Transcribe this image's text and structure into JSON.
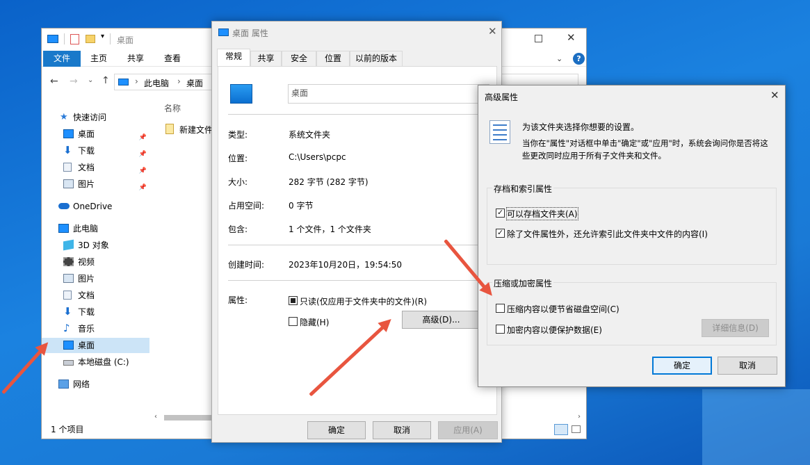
{
  "explorer": {
    "title": "桌面",
    "ribbon_tabs": [
      "文件",
      "主页",
      "共享",
      "查看"
    ],
    "breadcrumb": [
      "此电脑",
      "桌面"
    ],
    "column_name": "名称",
    "file_item": "新建文件",
    "nav": {
      "quick_access": "快速访问",
      "qa_desktop": "桌面",
      "qa_downloads": "下载",
      "qa_documents": "文档",
      "qa_pictures": "图片",
      "onedrive": "OneDrive",
      "this_pc": "此电脑",
      "objects3d": "3D 对象",
      "videos": "视频",
      "pictures": "图片",
      "documents": "文档",
      "downloads": "下载",
      "music": "音乐",
      "desktop": "桌面",
      "local_disk": "本地磁盘 (C:)",
      "network": "网络"
    },
    "status": "1 个项目"
  },
  "props": {
    "title": "桌面 属性",
    "tabs": [
      "常规",
      "共享",
      "安全",
      "位置",
      "以前的版本"
    ],
    "name_value": "桌面",
    "type_label": "类型:",
    "type_value": "系统文件夹",
    "location_label": "位置:",
    "location_value": "C:\\Users\\pcpc",
    "size_label": "大小:",
    "size_value": "282 字节 (282 字节)",
    "disk_label": "占用空间:",
    "disk_value": "0 字节",
    "contains_label": "包含:",
    "contains_value": "1 个文件，1 个文件夹",
    "created_label": "创建时间:",
    "created_value": "2023年10月20日，19:54:50",
    "attr_label": "属性:",
    "readonly_label": "只读(仅应用于文件夹中的文件)(R)",
    "hidden_label": "隐藏(H)",
    "advanced_button": "高级(D)...",
    "ok": "确定",
    "cancel": "取消",
    "apply": "应用(A)"
  },
  "advanced": {
    "title": "高级属性",
    "intro": "为该文件夹选择你想要的设置。",
    "desc_line1": "当你在\"属性\"对话框中单击\"确定\"或\"应用\"时，系统会询问你是否将这",
    "desc_line2": "些更改同时应用于所有子文件夹和文件。",
    "archive_group": "存档和索引属性",
    "archive_cb": "可以存档文件夹(A)",
    "index_cb": "除了文件属性外，还允许索引此文件夹中文件的内容(I)",
    "compress_group": "压缩或加密属性",
    "compress_cb": "压缩内容以便节省磁盘空间(C)",
    "encrypt_cb": "加密内容以便保护数据(E)",
    "details_button": "详细信息(D)",
    "ok": "确定",
    "cancel": "取消"
  },
  "colors": {
    "accent": "#0078d7",
    "annotation_arrow": "#e8553f",
    "desktop_bg": "#1a7ad6"
  }
}
